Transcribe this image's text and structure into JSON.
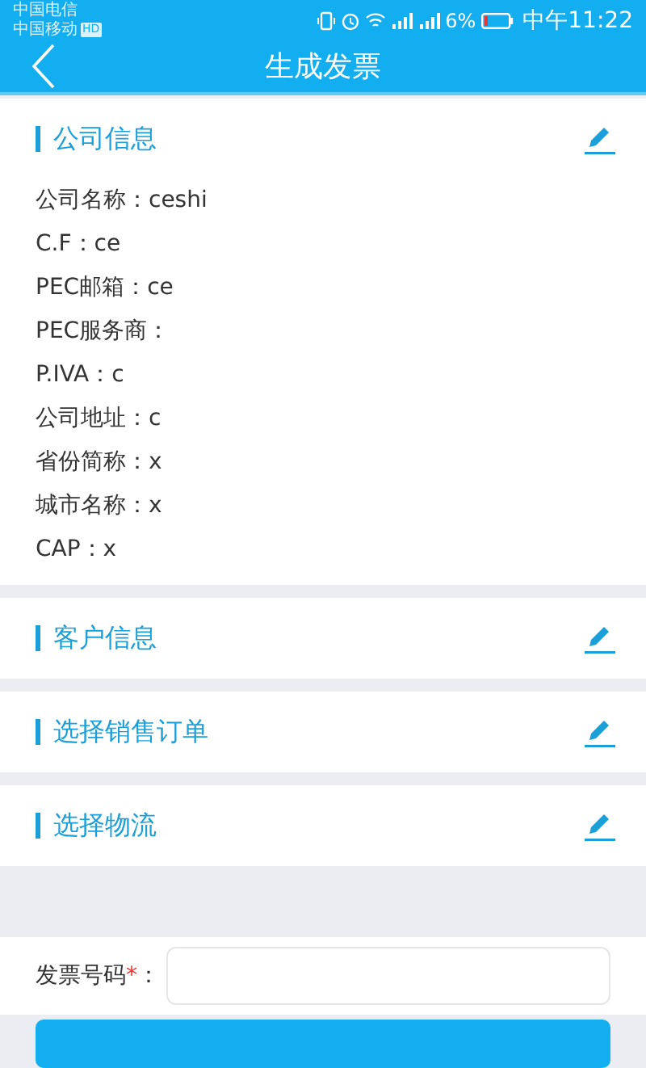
{
  "status_bar": {
    "carriers": [
      {
        "name": "中国电信"
      },
      {
        "name": "中国移动",
        "badge": "HD"
      }
    ],
    "battery": "6%",
    "time": "中午11:22"
  },
  "header": {
    "title": "生成发票"
  },
  "sections": [
    {
      "title": "公司信息",
      "fields": [
        {
          "label": "公司名称：",
          "value": "ceshi"
        },
        {
          "label": "C.F：",
          "value": "ce"
        },
        {
          "label": "PEC邮箱：",
          "value": "ce"
        },
        {
          "label": "PEC服务商："
        },
        {
          "label": "P.IVA：",
          "value": "c"
        },
        {
          "label": "公司地址：",
          "value": "c"
        },
        {
          "label": "省份简称：",
          "value": "x"
        },
        {
          "label": "城市名称：",
          "value": "x"
        },
        {
          "label": "CAP：",
          "value": "x"
        }
      ]
    },
    {
      "title": "客户信息"
    },
    {
      "title": "选择销售订单"
    },
    {
      "title": "选择物流"
    }
  ],
  "invoice_number": {
    "label": "发票号码",
    "required_mark": "*",
    "suffix": "："
  }
}
